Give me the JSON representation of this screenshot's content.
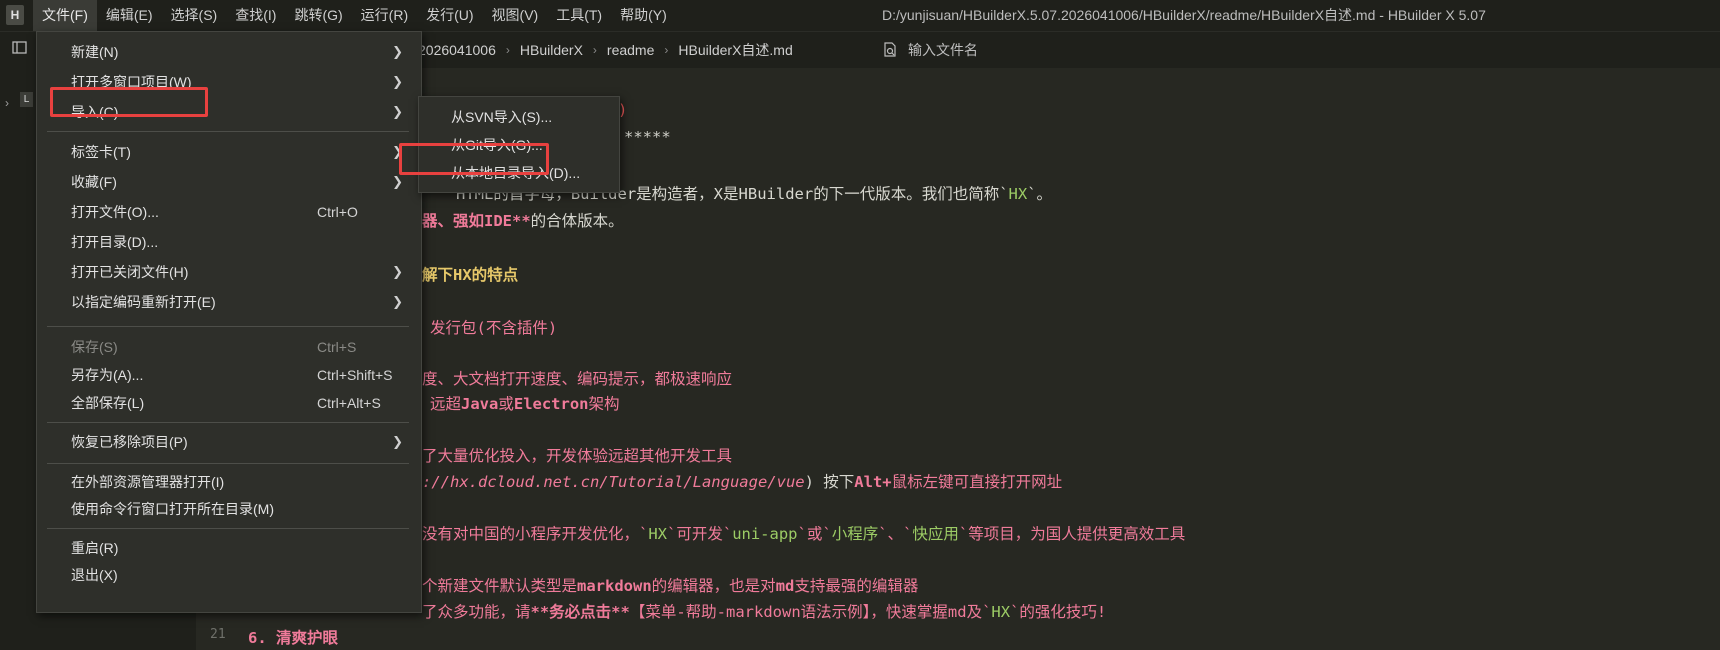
{
  "menubar": {
    "items": [
      "文件(F)",
      "编辑(E)",
      "选择(S)",
      "查找(I)",
      "跳转(G)",
      "运行(R)",
      "发行(U)",
      "视图(V)",
      "工具(T)",
      "帮助(Y)"
    ],
    "window_title": "D:/yunjisuan/HBuilderX.5.07.2026041006/HBuilderX/readme/HBuilderX自述.md - HBuilder X 5.07"
  },
  "toolbar": {
    "breadcrumb": [
      "2026041006",
      "HBuilderX",
      "readme",
      "HBuilderX自述.md"
    ],
    "search_placeholder": "输入文件名"
  },
  "explorer": {
    "root_letter": "L"
  },
  "file_menu": {
    "items": {
      "new": {
        "label": "新建(N)"
      },
      "open_multi": {
        "label": "打开多窗口项目(W)"
      },
      "import": {
        "label": "导入(C)"
      },
      "tabs": {
        "label": "标签卡(T)"
      },
      "favorites": {
        "label": "收藏(F)"
      },
      "open_file": {
        "label": "打开文件(O)...",
        "shortcut": "Ctrl+O"
      },
      "open_dir": {
        "label": "打开目录(D)..."
      },
      "open_closed": {
        "label": "打开已关闭文件(H)"
      },
      "reopen_encoding": {
        "label": "以指定编码重新打开(E)"
      },
      "save": {
        "label": "保存(S)",
        "shortcut": "Ctrl+S"
      },
      "save_as": {
        "label": "另存为(A)...",
        "shortcut": "Ctrl+Shift+S"
      },
      "save_all": {
        "label": "全部保存(L)",
        "shortcut": "Ctrl+Alt+S"
      },
      "restore_removed": {
        "label": "恢复已移除项目(P)"
      },
      "open_in_explorer": {
        "label": "在外部资源管理器打开(I)"
      },
      "open_in_terminal": {
        "label": "使用命令行窗口打开所在目录(M)"
      },
      "restart": {
        "label": "重启(R)"
      },
      "exit": {
        "label": "退出(X)"
      }
    }
  },
  "import_submenu": {
    "items": [
      "从SVN导入(S)...",
      "从Git导入(G)...",
      "从本地目录导入(D)..."
    ]
  },
  "editor": {
    "line_number": "21",
    "l1_a": "*****",
    "l2_a": "HTML的首字母，",
    "l2_b": "Builder",
    "l2_c": "是构造者，",
    "l2_d": "X",
    "l2_e": "是",
    "l2_f": "HBuilder",
    "l2_g": "的下一代版本。我们也简称`",
    "l2_h": "HX",
    "l2_i": "`。",
    "l3_a": "器、强如IDE**",
    "l3_b": "的合体版本。",
    "l4_a": "解下HX的特点",
    "l5_a": "发行包(不含插件)",
    "l6_a": "度、大文档打开速度、编码提示，都极速响应",
    "l7_a": "远超",
    "l7_b": "Java",
    "l7_c": "或",
    "l7_d": "Electron",
    "l7_e": "架构",
    "l8_a": "了大量优化投入，开发体验远超其他开发工具",
    "l9_a": "://hx.dcloud.net.cn/Tutorial/Language/vue",
    "l9_b": ") 按下",
    "l9_c": "Alt+",
    "l9_d": "鼠标左键可直接打开网址",
    "l10_a": "没有对中国的小程序开发优化，`",
    "l10_b": "HX",
    "l10_c": "`可开发`",
    "l10_d": "uni-app",
    "l10_e": "`或`",
    "l10_f": "小程序",
    "l10_g": "`、`",
    "l10_h": "快应用",
    "l10_i": "`等项目，为国人提供更高效工具",
    "l11_a": "个新建文件默认类型是",
    "l11_b": "markdown",
    "l11_c": "的编辑器，也是对",
    "l11_d": "md",
    "l11_e": "支持最强的编辑器",
    "l12_a": "了众多功能，请",
    "l12_b": "**务必点击**",
    "l12_c": "【菜单-帮助-markdown语法示例】，快速掌握md及`",
    "l12_d": "HX",
    "l12_e": "`的强化技巧!",
    "l13_a": "6. 清爽护眼"
  },
  "colors": {
    "highlight": "#e8413f",
    "background": "#272822",
    "menu_bg": "#2e2f2a"
  }
}
